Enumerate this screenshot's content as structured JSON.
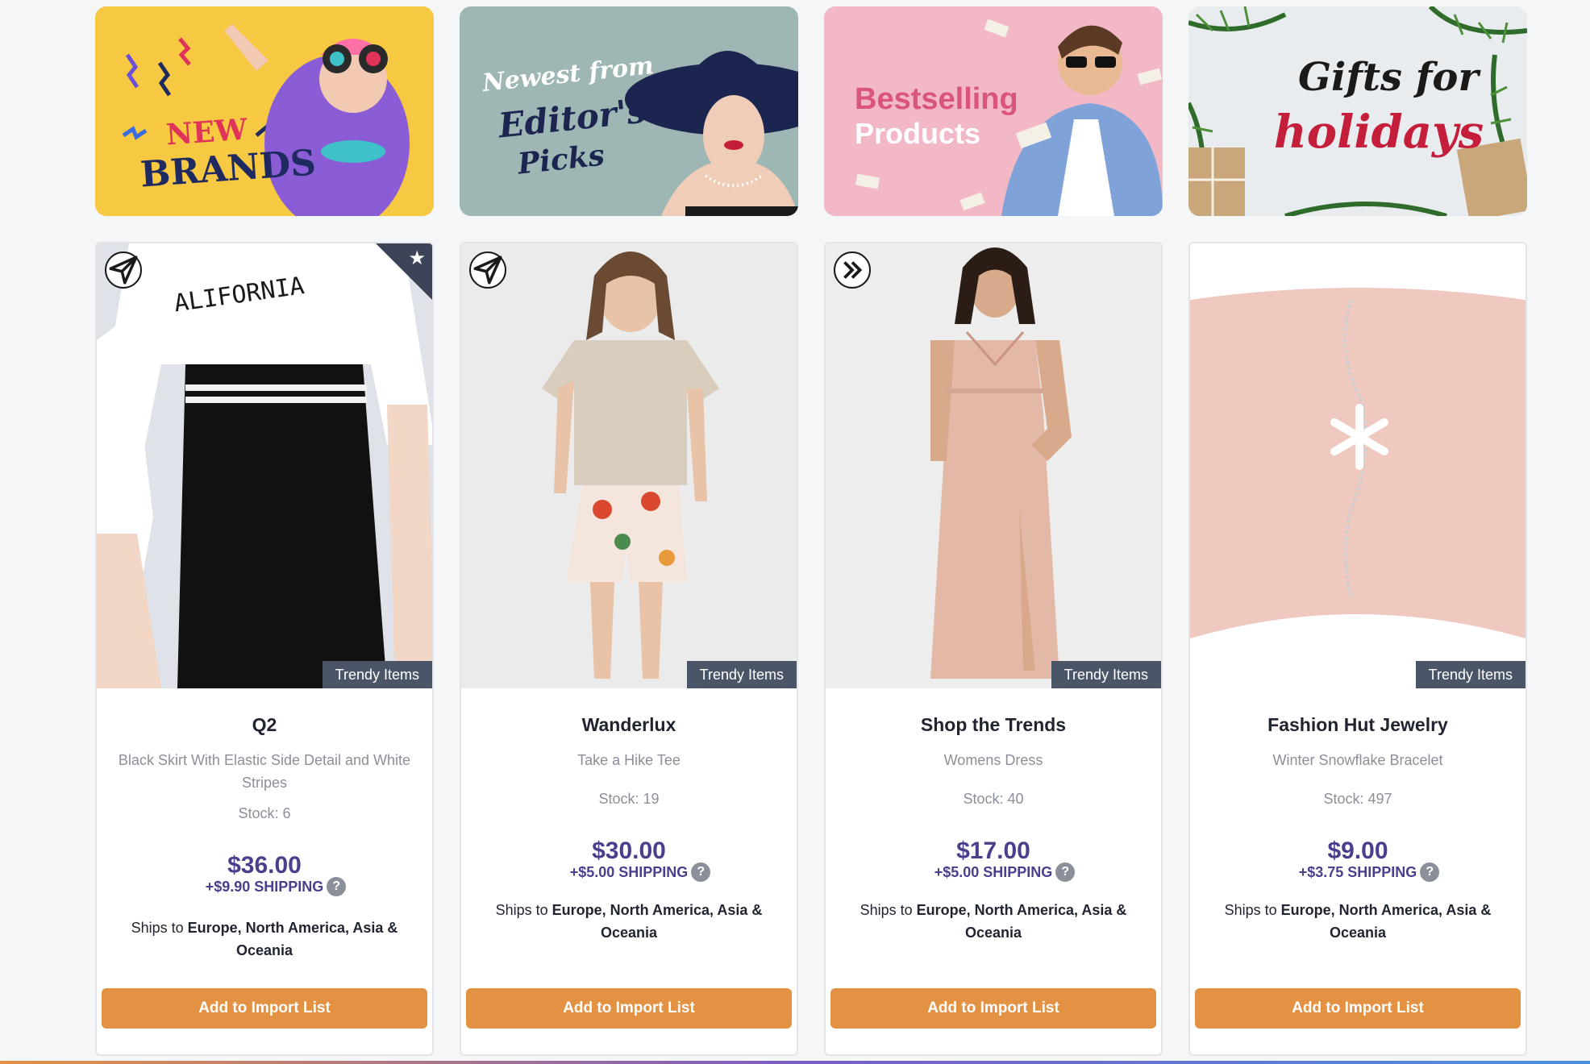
{
  "banners": [
    {
      "name": "new-brands",
      "line1": "NEW",
      "line2": "BRANDS",
      "bg": "#f7c841"
    },
    {
      "name": "editors-picks",
      "line1": "Newest from",
      "line2": "Editor's",
      "line3": "Picks",
      "bg": "#9fb7b4"
    },
    {
      "name": "bestselling",
      "line1": "Bestselling",
      "line2": "Products",
      "bg": "#f2b8c6"
    },
    {
      "name": "gifts-holidays",
      "line1": "Gifts for",
      "line2": "holidays",
      "bg": "#e9ecef"
    }
  ],
  "cards": [
    {
      "brand": "Q2",
      "product": "Black Skirt With Elastic Side Detail and White Stripes",
      "stock": "Stock: 6",
      "price": "$36.00",
      "shipping": "+$9.90 SHIPPING",
      "ships_prefix": "Ships to ",
      "ships_regions": "Europe, North America, Asia & Oceania",
      "tag": "Trendy Items",
      "button": "Add to Import List",
      "badge_icon": "send-icon"
    },
    {
      "brand": "Wanderlux",
      "product": "Take a Hike Tee",
      "stock": "Stock: 19",
      "price": "$30.00",
      "shipping": "+$5.00 SHIPPING",
      "ships_prefix": "Ships to ",
      "ships_regions": "Europe, North America, Asia & Oceania",
      "tag": "Trendy Items",
      "button": "Add to Import List",
      "badge_icon": "send-icon"
    },
    {
      "brand": "Shop the Trends",
      "product": "Womens Dress",
      "stock": "Stock: 40",
      "price": "$17.00",
      "shipping": "+$5.00 SHIPPING",
      "ships_prefix": "Ships to ",
      "ships_regions": "Europe, North America, Asia & Oceania",
      "tag": "Trendy Items",
      "button": "Add to Import List",
      "badge_icon": "fast-forward-icon"
    },
    {
      "brand": "Fashion Hut Jewelry",
      "product": "Winter Snowflake Bracelet",
      "stock": "Stock: 497",
      "price": "$9.00",
      "shipping": "+$3.75 SHIPPING",
      "ships_prefix": "Ships to ",
      "ships_regions": "Europe, North America, Asia & Oceania",
      "tag": "Trendy Items",
      "button": "Add to Import List",
      "badge_icon": ""
    }
  ],
  "help_glyph": "?",
  "star_glyph": "★",
  "colors": {
    "accent": "#e39244",
    "price": "#4a3f8c",
    "tag": "#4a5568"
  }
}
